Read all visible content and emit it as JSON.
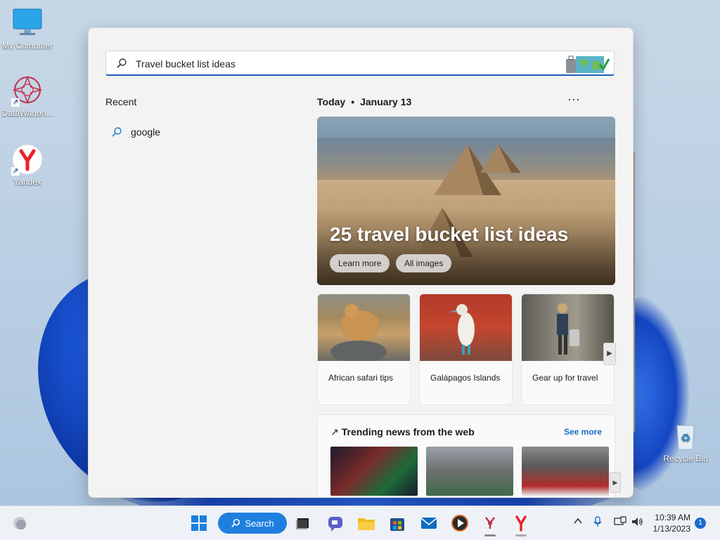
{
  "desktop": {
    "icons": [
      {
        "label": "My Computer"
      },
      {
        "label": "DataWagon..."
      },
      {
        "label": "Yandex"
      },
      {
        "label": "Recycle Bin"
      }
    ]
  },
  "search_panel": {
    "query": "Travel bucket list ideas",
    "recent_title": "Recent",
    "recent_items": [
      {
        "label": "google"
      }
    ],
    "today_label": "Today",
    "date_label": "January 13",
    "more_label": "···",
    "hero": {
      "title": "25 travel bucket list ideas",
      "buttons": [
        "Learn more",
        "All images"
      ]
    },
    "cards": [
      {
        "caption": "African safari tips"
      },
      {
        "caption": "Galápagos Islands"
      },
      {
        "caption": "Gear up for travel"
      }
    ],
    "trending": {
      "title": "Trending news from the web",
      "see_more": "See more"
    }
  },
  "taskbar": {
    "search_label": "Search",
    "time": "10:39 AM",
    "date": "1/13/2023",
    "notification_count": "1"
  },
  "colors": {
    "accent": "#1e7fdf",
    "link": "#1a6cc8",
    "panel_bg": "#f3f3f3"
  }
}
